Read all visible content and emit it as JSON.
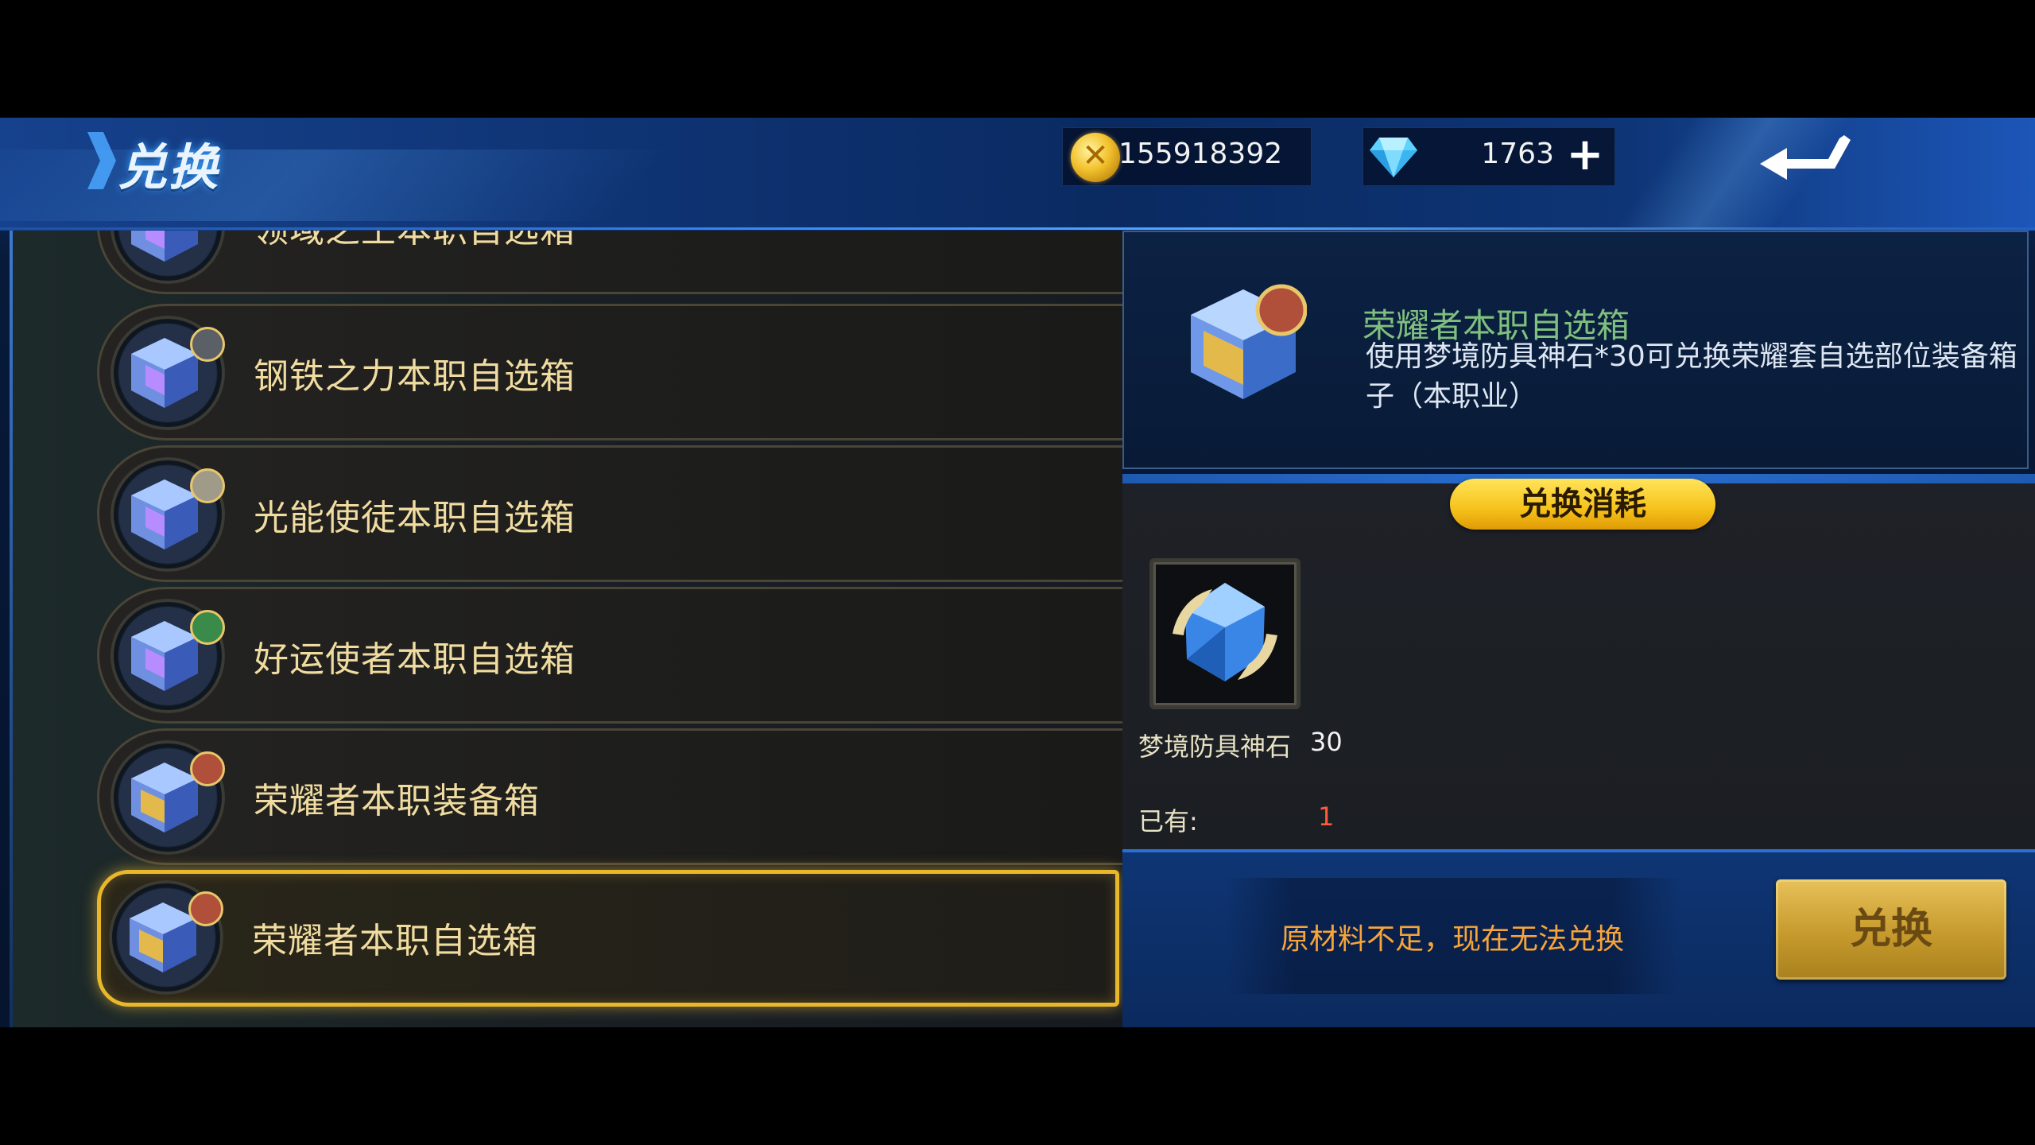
{
  "header": {
    "title": "兑换",
    "gold": "155918392",
    "gems": "1763",
    "gem_add": "+"
  },
  "list": {
    "items": [
      {
        "label": "领域之王本职自选箱",
        "badge_color": "#7a5aa0"
      },
      {
        "label": "钢铁之力本职自选箱",
        "badge_color": "#5b5f66"
      },
      {
        "label": "光能使徒本职自选箱",
        "badge_color": "#a09a88"
      },
      {
        "label": "好运使者本职自选箱",
        "badge_color": "#3a8a4a"
      },
      {
        "label": "荣耀者本职装备箱",
        "badge_color": "#b0503a"
      },
      {
        "label": "荣耀者本职自选箱",
        "badge_color": "#b0503a",
        "selected": true
      }
    ]
  },
  "detail": {
    "name": "荣耀者本职自选箱",
    "description": "使用梦境防具神石*30可兑换荣耀套自选部位装备箱子（本职业）"
  },
  "cost": {
    "heading": "兑换消耗",
    "material_name": "梦境防具神石",
    "material_qty": "30",
    "owned_label": "已有:",
    "owned_value": "1"
  },
  "footer": {
    "warning": "原材料不足，现在无法兑换",
    "exchange_label": "兑换"
  },
  "colors": {
    "accent_gold": "#e8b82a",
    "warning": "#f7a43a",
    "owned_insufficient": "#ff5a3a"
  }
}
